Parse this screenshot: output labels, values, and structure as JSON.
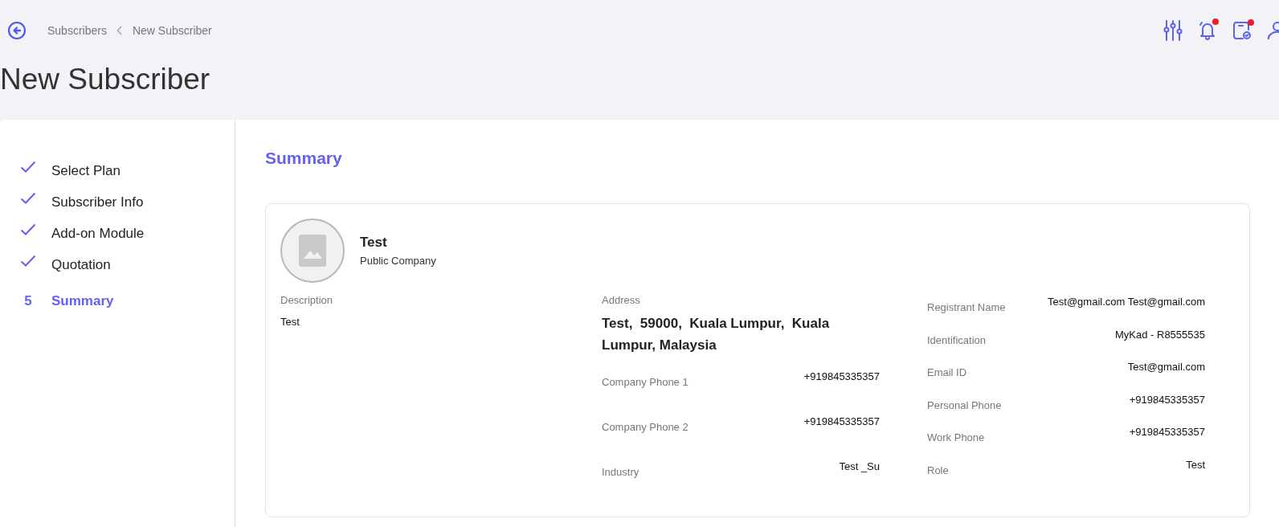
{
  "breadcrumb": [
    "Subscribers",
    "New Subscriber"
  ],
  "page_title": "New Subscriber",
  "header_icons": [
    {
      "kind": "sliders",
      "badge": false
    },
    {
      "kind": "bell",
      "badge": true
    },
    {
      "kind": "calendar",
      "badge": true
    },
    {
      "kind": "user",
      "badge": false
    }
  ],
  "steps": [
    {
      "label": "Select Plan",
      "completed": true,
      "selected": false
    },
    {
      "label": "Subscriber Info",
      "completed": true,
      "selected": false
    },
    {
      "label": "Add-on Module",
      "completed": true,
      "selected": false
    },
    {
      "label": "Quotation",
      "completed": true,
      "selected": false
    },
    {
      "label": "Summary",
      "number": "5",
      "completed": false,
      "selected": true
    }
  ],
  "section_title": "Summary",
  "company": {
    "name": "Test",
    "type": "Public Company"
  },
  "description": {
    "label": "Description",
    "value": "Test"
  },
  "address": {
    "label": "Address",
    "value": "Test,  59000,  Kuala Lumpur,  Kuala Lumpur, Malaysia"
  },
  "company_fields": [
    {
      "label": "Company Phone 1",
      "value": "+919845335357"
    },
    {
      "label": "Company Phone 2",
      "value": "+919845335357"
    },
    {
      "label": "Industry",
      "value": "Test _Su"
    }
  ],
  "contact_fields": [
    {
      "label": "Registrant Name",
      "value": "Test@gmail.com Test@gmail.com"
    },
    {
      "label": "Identification",
      "value": "MyKad - R8555535"
    },
    {
      "label": "Email ID",
      "value": "Test@gmail.com"
    },
    {
      "label": "Personal Phone",
      "value": "+919845335357"
    },
    {
      "label": "Work Phone",
      "value": "+919845335357"
    },
    {
      "label": "Role",
      "value": "Test"
    }
  ]
}
